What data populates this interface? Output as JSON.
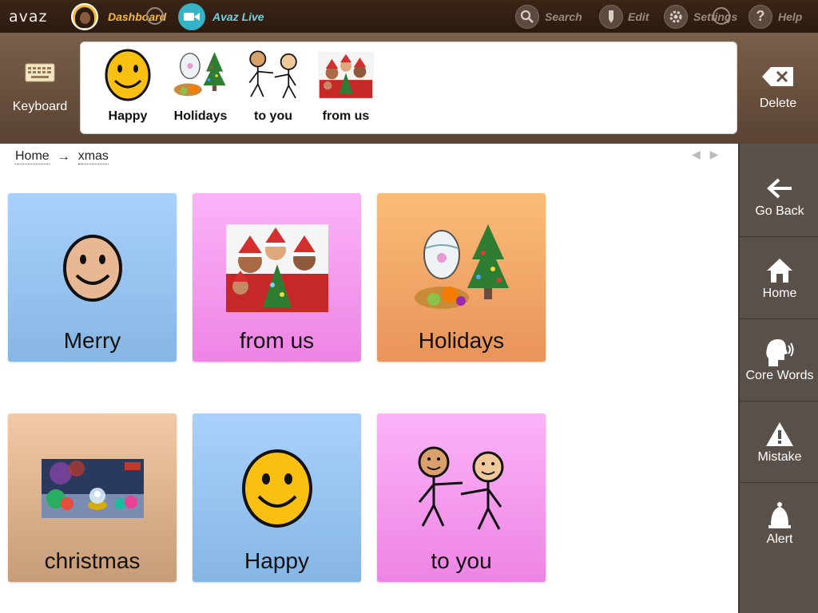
{
  "app": {
    "logo": "avaz"
  },
  "topbar": {
    "dashboard_label": "Dashboard",
    "live_label": "Avaz Live",
    "search_label": "Search",
    "edit_label": "Edit",
    "settings_label": "Settings",
    "help_label": "Help"
  },
  "strip": {
    "keyboard_label": "Keyboard",
    "delete_label": "Delete",
    "words": [
      {
        "label": "Happy"
      },
      {
        "label": "Holidays"
      },
      {
        "label": "to you"
      },
      {
        "label": "from us"
      }
    ]
  },
  "breadcrumb": {
    "home": "Home",
    "arrow": "→",
    "current": "xmas",
    "pager": "◀ ▶"
  },
  "tiles": [
    {
      "label": "Merry",
      "color": "#a9d1fb"
    },
    {
      "label": "from us",
      "color": "#fbb3f8"
    },
    {
      "label": "Holidays",
      "color": "#fbbc78"
    },
    {
      "label": "christmas",
      "color": "#f2c9a6"
    },
    {
      "label": "Happy",
      "color": "#a9d1fb"
    },
    {
      "label": "to you",
      "color": "#fbb3f8"
    }
  ],
  "sidebar": {
    "items": [
      {
        "label": "Go Back",
        "icon": "arrow-left-icon"
      },
      {
        "label": "Home",
        "icon": "home-icon"
      },
      {
        "label": "Core Words",
        "icon": "speaking-head-icon"
      },
      {
        "label": "Mistake",
        "icon": "warning-icon"
      },
      {
        "label": "Alert",
        "icon": "bell-icon"
      }
    ]
  }
}
